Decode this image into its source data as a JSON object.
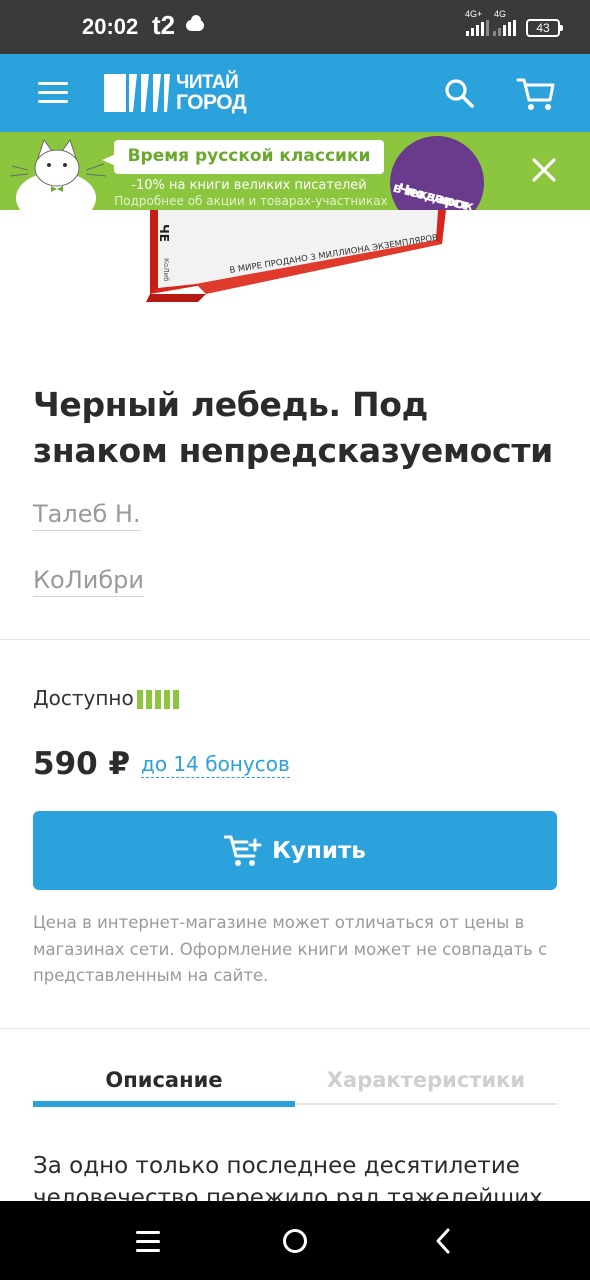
{
  "status_bar": {
    "time": "20:02",
    "carrier": "t2",
    "net1": "4G+",
    "net2": "4G",
    "battery": "43"
  },
  "header": {
    "logo_line1": "ЧИТАЙ",
    "logo_line2": "ГОРОД",
    "brand_color": "#2ca2dd"
  },
  "promo": {
    "title": "Время русской классики",
    "subtitle": "-10% на книги великих писателей",
    "note": "Подробнее об акции и товарах-участниках",
    "badge_line1": "Чек-лист",
    "badge_line2": "в подарок",
    "color": "#8cc63f"
  },
  "book_image": {
    "caption": "В МИРЕ ПРОДАНО 3 МИЛЛИОНА ЭКЗЕМПЛЯРОВ"
  },
  "product": {
    "title": "Черный лебедь. Под знаком непредсказуемости",
    "author": "Талеб Н.",
    "publisher": "КоЛибри",
    "availability_label": "Доступно",
    "availability_level": 5,
    "availability_max": 5,
    "price": "590 ₽",
    "bonus": "до 14 бонусов",
    "buy_label": "Купить",
    "note": "Цена в интернет-магазине может отличаться от цены в магазинах сети. Оформление книги может не совпадать с представленным на сайте."
  },
  "tabs": [
    {
      "label": "Описание",
      "active": true
    },
    {
      "label": "Характеристики",
      "active": false
    }
  ],
  "description": {
    "text": "За одно только последнее десятилетие человечество пережило ряд тяжелейших"
  }
}
